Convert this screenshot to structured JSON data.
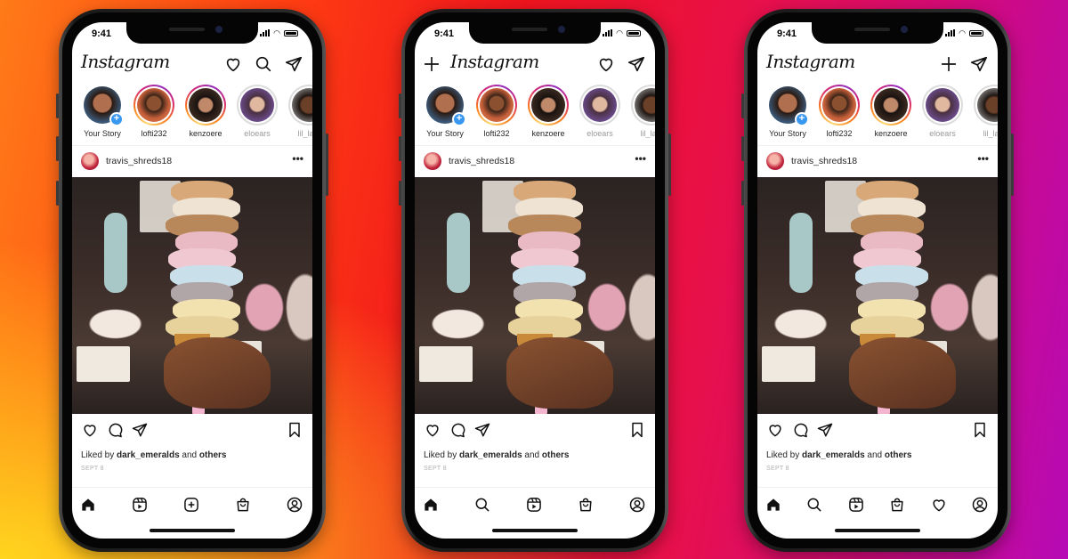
{
  "background": {
    "gradient_colors": [
      "#ffd51e",
      "#ff7a18",
      "#f0141e",
      "#d40a78",
      "#b60ab6"
    ]
  },
  "phones": [
    {
      "variant": "current",
      "status_time": "9:41",
      "app_title": "Instagram",
      "top_icons": [
        "heart-icon",
        "search-icon",
        "direct-message-icon"
      ],
      "stories": [
        {
          "name": "Your Story",
          "state": "own"
        },
        {
          "name": "lofti232",
          "state": "new"
        },
        {
          "name": "kenzoere",
          "state": "new"
        },
        {
          "name": "eloears",
          "state": "seen"
        },
        {
          "name": "lil_lapi",
          "state": "seen"
        }
      ],
      "post": {
        "username": "travis_shreds18",
        "more": "•••",
        "liked_prefix": "Liked by ",
        "liked_user": "dark_emeralds",
        "liked_mid": " and ",
        "liked_others": "others",
        "date": "SEPT 8"
      },
      "tabs": [
        "home",
        "reels",
        "create",
        "shop",
        "profile"
      ]
    },
    {
      "variant": "test-a",
      "status_time": "9:41",
      "app_title": "Instagram",
      "top_icons": [
        "create-icon",
        "heart-icon",
        "direct-message-icon"
      ],
      "stories": [
        {
          "name": "Your Story",
          "state": "own"
        },
        {
          "name": "lofti232",
          "state": "new"
        },
        {
          "name": "kenzoere",
          "state": "new"
        },
        {
          "name": "eloears",
          "state": "seen"
        },
        {
          "name": "lil_lapi",
          "state": "seen"
        }
      ],
      "post": {
        "username": "travis_shreds18",
        "more": "•••",
        "liked_prefix": "Liked by ",
        "liked_user": "dark_emeralds",
        "liked_mid": " and ",
        "liked_others": "others",
        "date": "SEPT 8"
      },
      "tabs": [
        "home",
        "search",
        "reels",
        "shop",
        "profile"
      ]
    },
    {
      "variant": "test-b",
      "status_time": "9:41",
      "app_title": "Instagram",
      "top_icons": [
        "create-icon",
        "direct-message-icon"
      ],
      "stories": [
        {
          "name": "Your Story",
          "state": "own"
        },
        {
          "name": "lofti232",
          "state": "new"
        },
        {
          "name": "kenzoere",
          "state": "new"
        },
        {
          "name": "eloears",
          "state": "seen"
        },
        {
          "name": "lil_lapi",
          "state": "seen"
        }
      ],
      "post": {
        "username": "travis_shreds18",
        "more": "•••",
        "liked_prefix": "Liked by ",
        "liked_user": "dark_emeralds",
        "liked_mid": " and ",
        "liked_others": "others",
        "date": "SEPT 8"
      },
      "tabs": [
        "home",
        "search",
        "reels",
        "shop",
        "activity",
        "profile"
      ]
    }
  ]
}
